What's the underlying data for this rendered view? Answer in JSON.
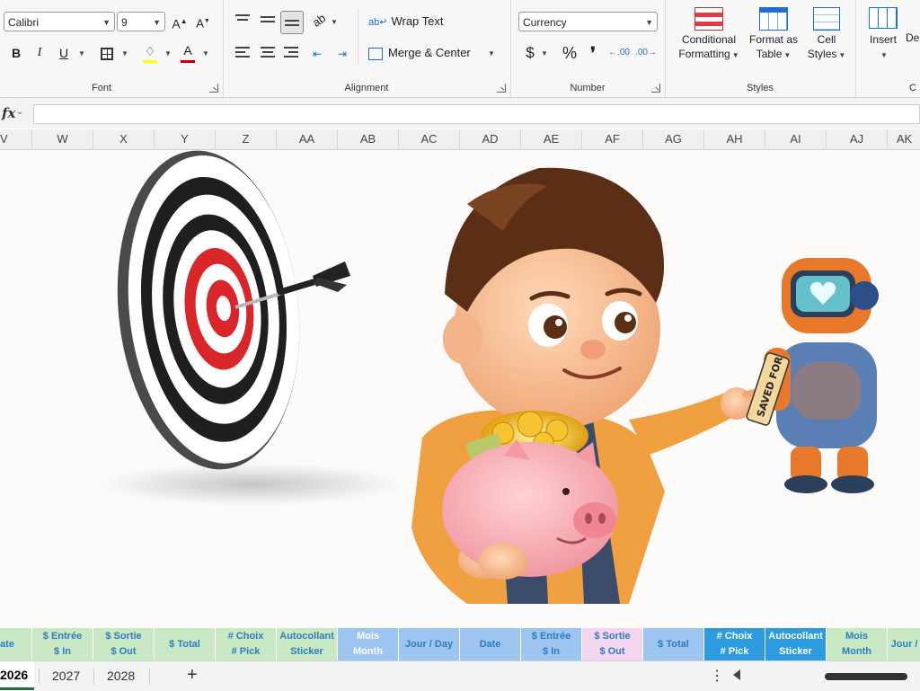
{
  "ribbon": {
    "font": {
      "name": "Calibri",
      "size": "9",
      "group_label": "Font",
      "bold": "B",
      "italic": "I",
      "underline": "U"
    },
    "alignment": {
      "wrap_text": "Wrap Text",
      "merge_center": "Merge & Center",
      "group_label": "Alignment"
    },
    "number": {
      "format": "Currency",
      "currency_symbol": "$",
      "percent_symbol": "%",
      "comma_symbol": "❜",
      "inc_decimal": ".00",
      "dec_decimal": ".00",
      "group_label": "Number"
    },
    "styles": {
      "conditional_formatting": [
        "Conditional",
        "Formatting"
      ],
      "format_as_table": [
        "Format as",
        "Table"
      ],
      "cell_styles": [
        "Cell",
        "Styles"
      ],
      "group_label": "Styles"
    },
    "cells": {
      "insert": "Insert",
      "delete": "De",
      "group_label": "C"
    }
  },
  "formula_bar": {
    "fx": "fx",
    "value": ""
  },
  "columns": [
    "V",
    "W",
    "X",
    "Y",
    "Z",
    "AA",
    "AB",
    "AC",
    "AD",
    "AE",
    "AF",
    "AG",
    "AH",
    "AI",
    "AJ",
    "AK"
  ],
  "header_row": [
    {
      "line1": "ate",
      "line2": "",
      "bg": "#c9e9c4",
      "fg": "#2e7bbf"
    },
    {
      "line1": "$ Entrée",
      "line2": "$ In",
      "bg": "#c9e9c4",
      "fg": "#2e7bbf"
    },
    {
      "line1": "$ Sortie",
      "line2": "$ Out",
      "bg": "#c9e9c4",
      "fg": "#2e7bbf"
    },
    {
      "line1": "$ Total",
      "line2": "",
      "bg": "#c9e9c4",
      "fg": "#2e7bbf"
    },
    {
      "line1": "# Choix",
      "line2": "# Pick",
      "bg": "#c9e9c4",
      "fg": "#2e7bbf"
    },
    {
      "line1": "Autocollant",
      "line2": "Sticker",
      "bg": "#c9e9c4",
      "fg": "#2e7bbf"
    },
    {
      "line1": "Mois",
      "line2": "Month",
      "bg": "#9ec5f0",
      "fg": "#ffffff"
    },
    {
      "line1": "Jour / Day",
      "line2": "",
      "bg": "#9ec5f0",
      "fg": "#2e7bbf"
    },
    {
      "line1": "Date",
      "line2": "",
      "bg": "#9ec5f0",
      "fg": "#2e7bbf"
    },
    {
      "line1": "$ Entrée",
      "line2": "$ In",
      "bg": "#9ec5f0",
      "fg": "#2e7bbf"
    },
    {
      "line1": "$ Sortie",
      "line2": "$ Out",
      "bg": "#f2d6ef",
      "fg": "#2e7bbf"
    },
    {
      "line1": "$ Total",
      "line2": "",
      "bg": "#9ec5f0",
      "fg": "#2e7bbf"
    },
    {
      "line1": "# Choix",
      "line2": "# Pick",
      "bg": "#2d9be0",
      "fg": "#ffffff"
    },
    {
      "line1": "Autocollant",
      "line2": "Sticker",
      "bg": "#2d9be0",
      "fg": "#ffffff"
    },
    {
      "line1": "Mois",
      "line2": "Month",
      "bg": "#c9e9c4",
      "fg": "#2e7bbf"
    },
    {
      "line1": "Jour /",
      "line2": "",
      "bg": "#c9e9c4",
      "fg": "#2e7bbf"
    }
  ],
  "sheet_art": {
    "robot_tag": "SAVED FOR"
  },
  "tabs": {
    "items": [
      "2026",
      "2027",
      "2028"
    ],
    "active": "2026"
  }
}
